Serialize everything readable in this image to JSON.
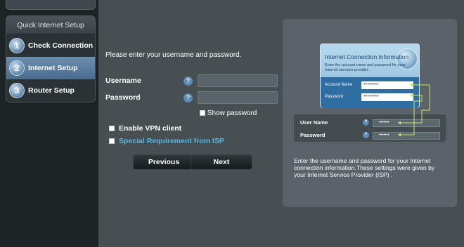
{
  "sidebar": {
    "header": "Quick Internet Setup",
    "steps": [
      {
        "num": "1",
        "label": "Check Connection"
      },
      {
        "num": "2",
        "label": "Internet Setup"
      },
      {
        "num": "3",
        "label": "Router Setup"
      }
    ]
  },
  "form": {
    "prompt": "Please enter your username and password.",
    "username_label": "Username",
    "password_label": "Password",
    "help_glyph": "?",
    "username_value": "",
    "password_value": "",
    "show_password_label": "Show password",
    "vpn_label": "Enable VPN client",
    "isp_label": "Special Requirement from ISP",
    "previous_label": "Previous",
    "next_label": "Next"
  },
  "illustration": {
    "card_title": "Internet Connection Information",
    "card_desc": "Enter the account name and password for your Internet services provider.",
    "account_name_label": "Account Name",
    "password_label": "Password",
    "masked_value": "********",
    "example_username_label": "User Name",
    "example_password_label": "Password",
    "example_masked": "•••••••",
    "help_glyph": "?"
  },
  "info_text": "Enter the username and password for your Internet connection information.These settings were given by your Internet Service Provider (ISP) .",
  "colors": {
    "background": "#474f53",
    "sidebar": "#1d2225",
    "active_step": "#5a7c9d",
    "link": "#53b7e6",
    "connector": "#c8e85a"
  }
}
